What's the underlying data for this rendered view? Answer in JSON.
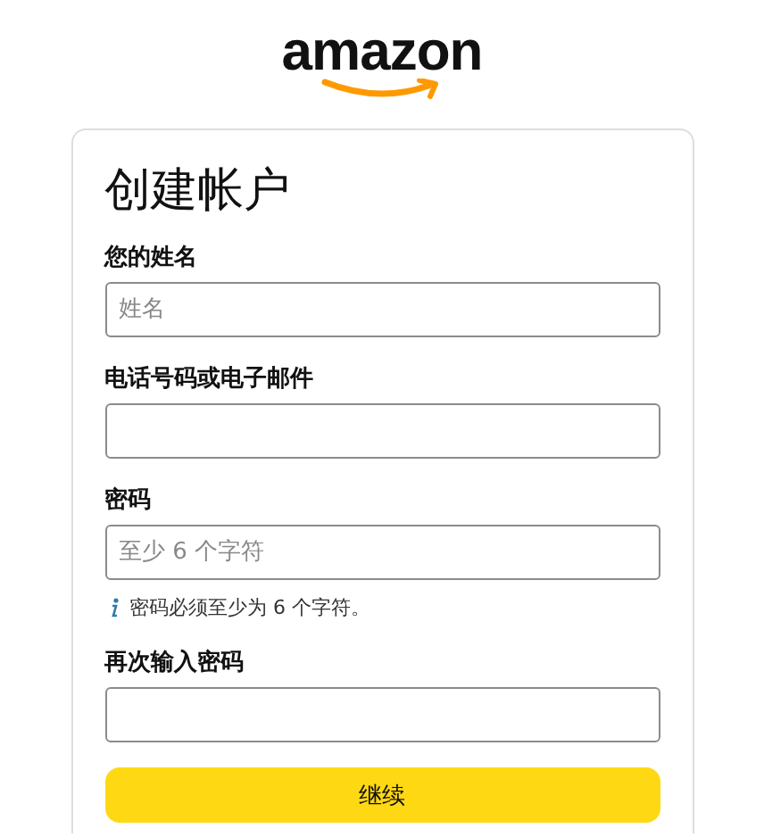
{
  "logo": {
    "text": "amazon"
  },
  "card": {
    "title": "创建帐户",
    "fields": [
      {
        "label": "您的姓名",
        "placeholder": "姓名"
      },
      {
        "label": "电话号码或电子邮件"
      },
      {
        "label": "密码",
        "placeholder": "至少 6 个字符",
        "hint": "密码必须至少为 6 个字符。"
      },
      {
        "label": "再次输入密码"
      }
    ],
    "button": "继续"
  }
}
